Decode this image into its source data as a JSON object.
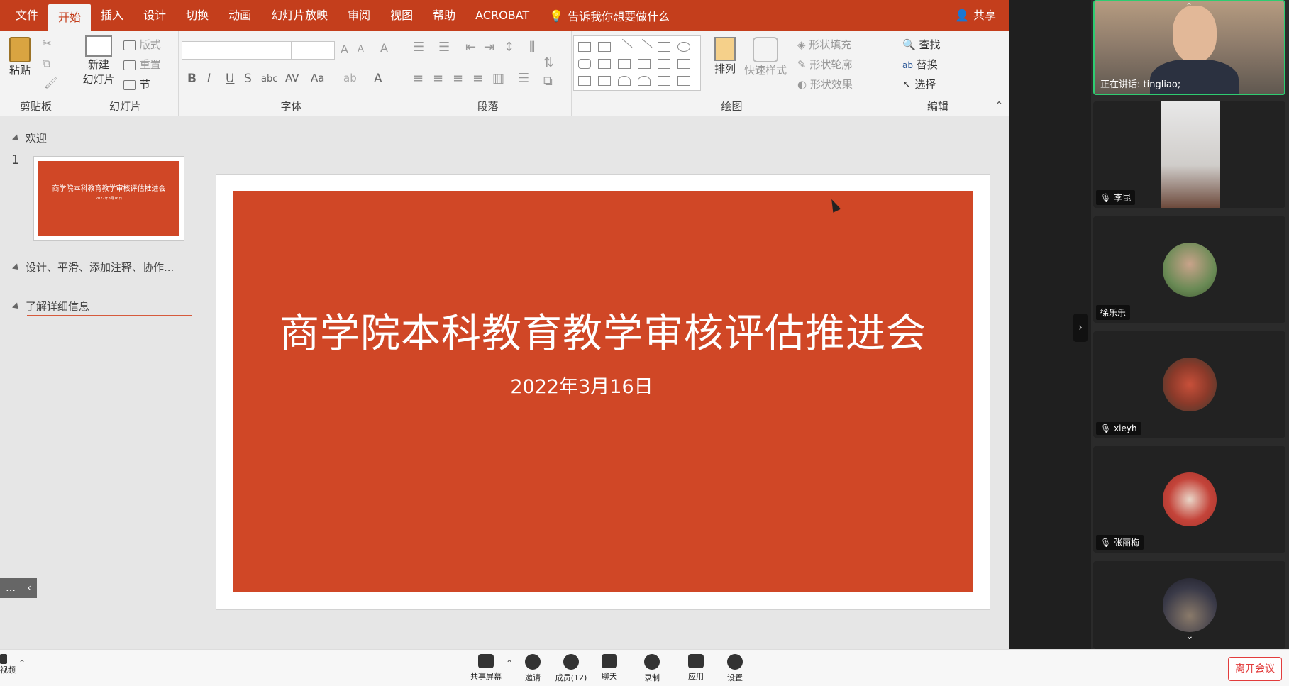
{
  "ppt": {
    "menu_tabs": [
      "文件",
      "开始",
      "插入",
      "设计",
      "切换",
      "动画",
      "幻灯片放映",
      "审阅",
      "视图",
      "帮助",
      "ACROBAT"
    ],
    "active_tab": "开始",
    "tell_me": "告诉我你想要做什么",
    "share": "共享",
    "ribbon": {
      "clipboard": {
        "label": "剪贴板",
        "paste": "粘贴"
      },
      "slides": {
        "label": "幻灯片",
        "new_slide_line1": "新建",
        "new_slide_line2": "幻灯片",
        "layout": "版式",
        "reset": "重置",
        "section": "节"
      },
      "font": {
        "label": "字体"
      },
      "paragraph": {
        "label": "段落"
      },
      "drawing": {
        "label": "绘图",
        "arrange": "排列",
        "quick_styles": "快速样式",
        "shape_fill": "形状填充",
        "shape_outline": "形状轮廓",
        "shape_effects": "形状效果"
      },
      "editing": {
        "label": "编辑",
        "find": "查找",
        "replace": "替换",
        "select": "选择"
      }
    },
    "outline": {
      "section1": "欢迎",
      "slide_number": "1",
      "thumb_title": "商学院本科教育教学审核评估推进会",
      "thumb_date": "2022年3月16日",
      "section2": "设计、平滑、添加注释、协作...",
      "section3": "了解详细信息"
    },
    "slide": {
      "title": "商学院本科教育教学审核评估推进会",
      "date": "2022年3月16日"
    },
    "colors": {
      "accent": "#c43e1c",
      "slide_bg": "#d04726"
    }
  },
  "participants": {
    "speaking": "正在讲话: tingliao;",
    "tiles": [
      {
        "name": "李昆"
      },
      {
        "name": "徐乐乐"
      },
      {
        "name": "xieyh"
      },
      {
        "name": "张丽梅"
      }
    ]
  },
  "toolbar": {
    "left_video": "视频",
    "share_screen": "共享屏幕",
    "invite": "邀请",
    "members": "成员(12)",
    "chat": "聊天",
    "record": "录制",
    "apps": "应用",
    "settings": "设置",
    "leave": "离开会议"
  }
}
